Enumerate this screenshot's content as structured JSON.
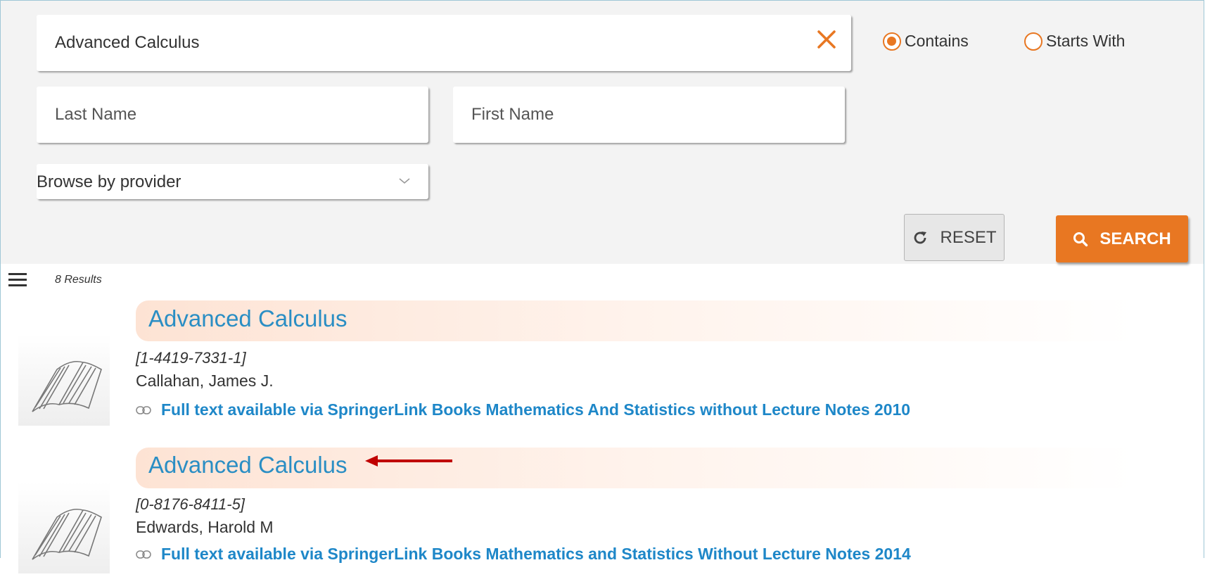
{
  "search": {
    "title_value": "Advanced Calculus",
    "lastname_placeholder": "Last Name",
    "firstname_placeholder": "First Name",
    "provider_placeholder": "Browse by provider",
    "match_options": [
      {
        "label": "Contains",
        "selected": true
      },
      {
        "label": "Starts With",
        "selected": false
      }
    ],
    "reset_label": "RESET",
    "search_label": "SEARCH"
  },
  "results": {
    "count_label": "8 Results",
    "items": [
      {
        "title": "Advanced Calculus",
        "isbn": "[1-4419-7331-1]",
        "author": "Callahan, James J.",
        "fulltext": "Full text available via SpringerLink Books Mathematics And Statistics without Lecture Notes 2010"
      },
      {
        "title": "Advanced Calculus",
        "isbn": "[0-8176-8411-5]",
        "author": "Edwards, Harold M",
        "fulltext": "Full text available via SpringerLink Books Mathematics and Statistics Without Lecture Notes 2014"
      }
    ]
  },
  "colors": {
    "accent": "#e87722",
    "link": "#1e87c8",
    "title_link": "#2a8ec4",
    "annotation_arrow": "#c00000"
  },
  "icons": {
    "clear": "close-icon",
    "reset": "refresh-icon",
    "search": "search-icon",
    "menu": "hamburger-menu-icon",
    "link": "link-icon",
    "book": "open-book-icon"
  }
}
